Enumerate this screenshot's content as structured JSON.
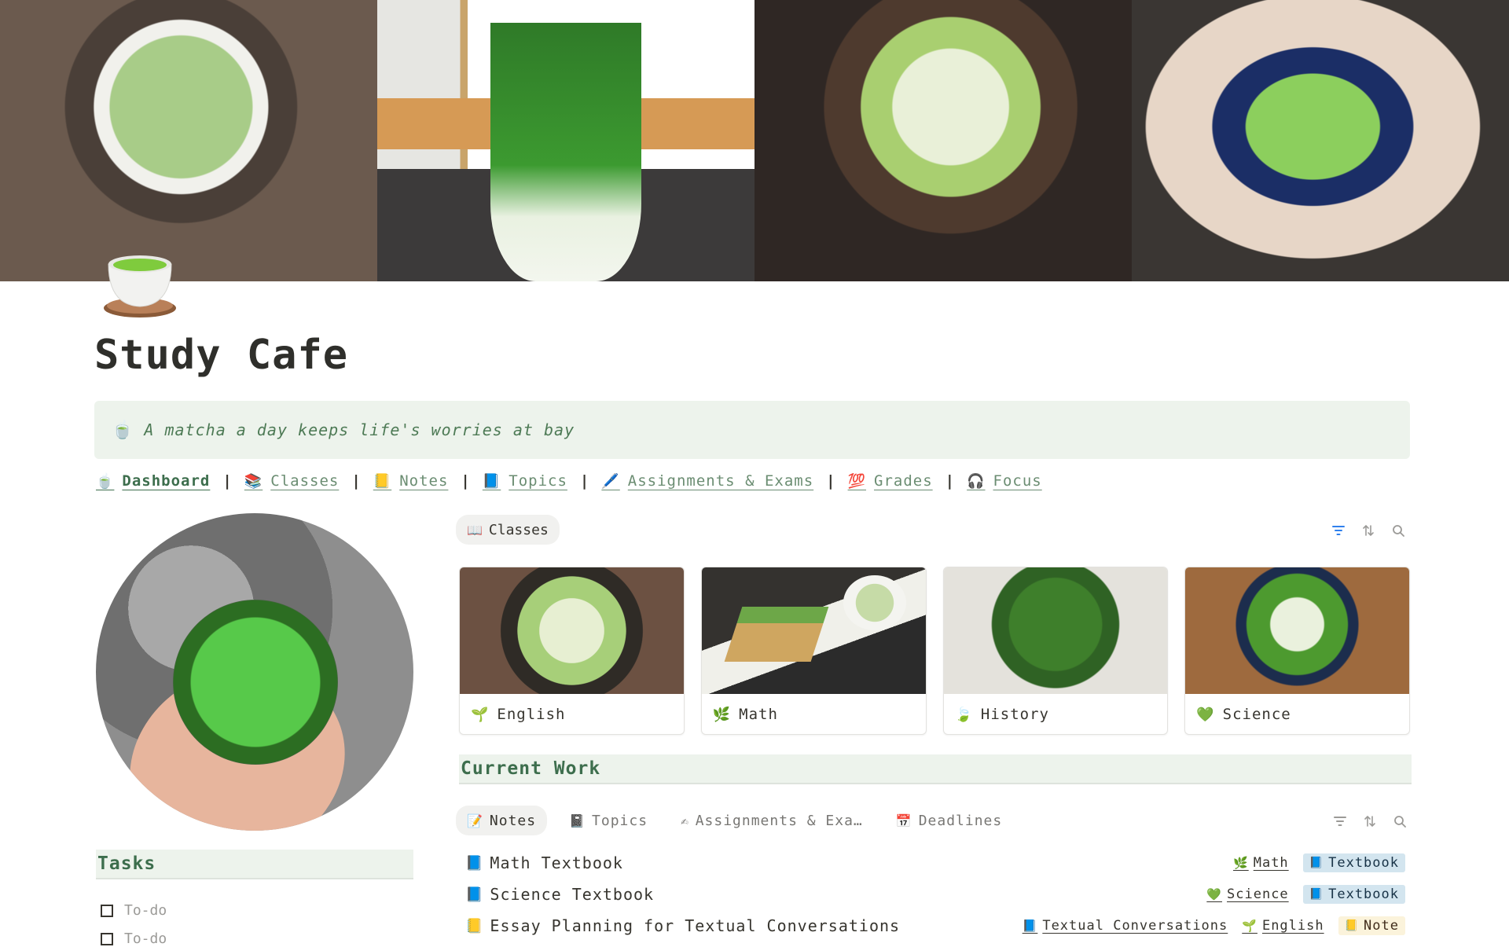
{
  "page": {
    "title": "Study Cafe",
    "icon": "matcha-teacup-icon",
    "quote": "A matcha a day keeps life's worries at bay",
    "quote_icon": "🍵"
  },
  "nav": [
    {
      "icon": "🍵",
      "label": "Dashboard",
      "active": true
    },
    {
      "icon": "📚",
      "label": "Classes"
    },
    {
      "icon": "📒",
      "label": "Notes"
    },
    {
      "icon": "📘",
      "label": "Topics"
    },
    {
      "icon": "🖊️",
      "label": "Assignments & Exams"
    },
    {
      "icon": "💯",
      "label": "Grades"
    },
    {
      "icon": "🎧",
      "label": "Focus"
    }
  ],
  "nav_separator": "|",
  "classes_view": {
    "label": "Classes",
    "icon": "📖",
    "cards": [
      {
        "icon": "🌱",
        "label": "English"
      },
      {
        "icon": "🌿",
        "label": "Math"
      },
      {
        "icon": "🍃",
        "label": "History"
      },
      {
        "icon": "💚",
        "label": "Science"
      }
    ]
  },
  "tasks": {
    "heading": "Tasks",
    "items": [
      {
        "label": "To-do",
        "checked": false
      },
      {
        "label": "To-do",
        "checked": false
      }
    ]
  },
  "current_work": {
    "heading": "Current Work",
    "tabs": [
      {
        "icon": "📝",
        "label": "Notes",
        "active": true
      },
      {
        "icon": "📓",
        "label": "Topics"
      },
      {
        "icon": "✍",
        "label": "Assignments & Exa…"
      },
      {
        "icon": "📅",
        "label": "Deadlines"
      }
    ],
    "rows": [
      {
        "icon": "📘",
        "title": "Math Textbook",
        "topic": "",
        "class_icon": "🌿",
        "class": "Math",
        "type_icon": "📘",
        "type": "Textbook",
        "type_color": "blue"
      },
      {
        "icon": "📘",
        "title": "Science Textbook",
        "topic": "",
        "class_icon": "💚",
        "class": "Science",
        "type_icon": "📘",
        "type": "Textbook",
        "type_color": "blue"
      },
      {
        "icon": "📒",
        "title": "Essay Planning for Textual Conversations",
        "topic_icon": "📘",
        "topic": "Textual Conversations",
        "class_icon": "🌱",
        "class": "English",
        "type_icon": "📒",
        "type": "Note",
        "type_color": "yellow"
      }
    ]
  },
  "colors": {
    "accent_green": "#3d6e4d",
    "callout_bg": "#edf3ec",
    "filter_blue": "#2f80ed"
  }
}
